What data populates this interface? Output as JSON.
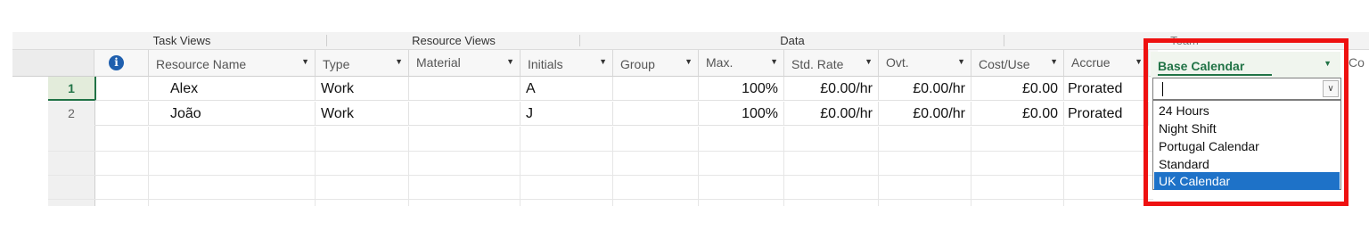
{
  "ribbon_groups": [
    "Task Views",
    "Resource Views",
    "Data",
    "Team"
  ],
  "columns": {
    "resource_name": "Resource Name",
    "type": "Type",
    "material": "Material",
    "initials": "Initials",
    "group": "Group",
    "max": "Max.",
    "std_rate": "Std. Rate",
    "ovt": "Ovt.",
    "cost_use": "Cost/Use",
    "accrue": "Accrue",
    "base_calendar": "Base Calendar",
    "next_partial": "Co"
  },
  "icons": {
    "info_header": "info-icon",
    "dropdown_arrow": "chevron-down-icon"
  },
  "rows": [
    {
      "num": "1",
      "name": "Alex",
      "type": "Work",
      "material": "",
      "initials": "A",
      "group": "",
      "max": "100%",
      "std_rate": "£0.00/hr",
      "ovt": "£0.00/hr",
      "cost_use": "£0.00",
      "accrue": "Prorated",
      "base_calendar": ""
    },
    {
      "num": "2",
      "name": "João",
      "type": "Work",
      "material": "",
      "initials": "J",
      "group": "",
      "max": "100%",
      "std_rate": "£0.00/hr",
      "ovt": "£0.00/hr",
      "cost_use": "£0.00",
      "accrue": "Prorated",
      "base_calendar": ""
    }
  ],
  "calendar_options": [
    "24 Hours",
    "Night Shift",
    "Portugal Calendar",
    "Standard",
    "UK Calendar"
  ],
  "selected_option": "UK Calendar",
  "colors": {
    "accent_green": "#217346",
    "highlight_red": "#ee1111",
    "selection_blue": "#1e72c8"
  }
}
